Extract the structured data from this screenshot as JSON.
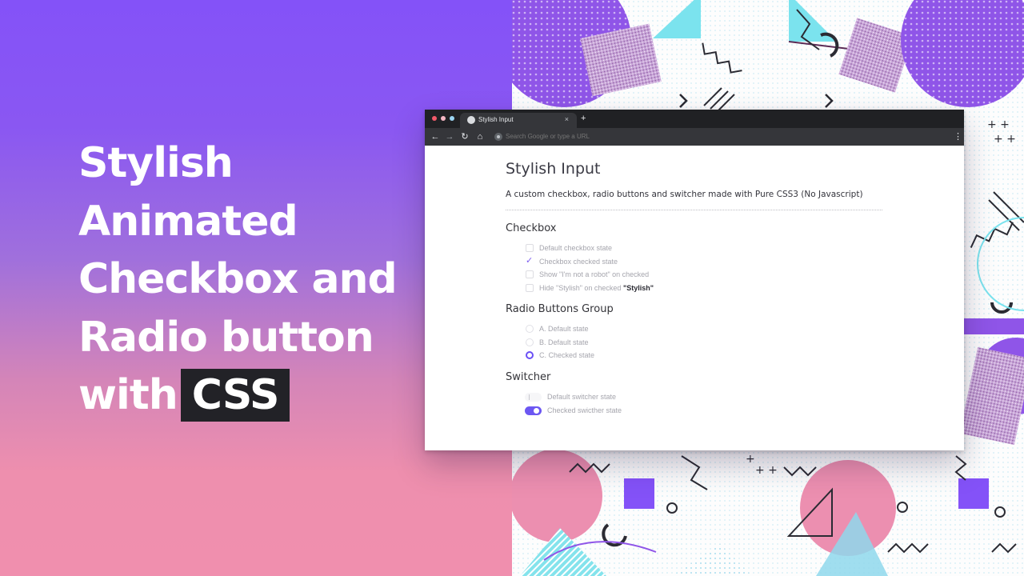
{
  "headline": {
    "lines": [
      "Stylish",
      "Animated",
      "Checkbox and",
      "Radio button"
    ],
    "last_prefix": "with",
    "highlight": "CSS"
  },
  "colors": {
    "gradient_top": "#8452f8",
    "gradient_bottom": "#f08fae",
    "accent": "#6c57f2",
    "browser_chrome": "#202124"
  },
  "browser": {
    "tab_title": "Stylish Input",
    "tab_close": "×",
    "new_tab": "+",
    "omnibox_placeholder": "Search Google or type a URL",
    "icons": {
      "back": "←",
      "forward": "→",
      "reload": "↻",
      "home": "⌂",
      "menu": "⋮"
    }
  },
  "page": {
    "title": "Stylish Input",
    "subtitle": "A custom checkbox, radio buttons and switcher made with Pure CSS3 (No Javascript)",
    "checkbox": {
      "title": "Checkbox",
      "items": [
        {
          "label": "Default checkbox state",
          "checked": false
        },
        {
          "label": "Checkbox checked state",
          "checked": true
        },
        {
          "label": "Show \"I'm not a robot\" on checked",
          "checked": false
        },
        {
          "label": "Hide \"Stylish\" on checked",
          "bold": "\"Stylish\"",
          "checked": false
        }
      ]
    },
    "radio": {
      "title": "Radio Buttons Group",
      "items": [
        {
          "label": "A. Default state",
          "checked": false
        },
        {
          "label": "B. Default state",
          "checked": false
        },
        {
          "label": "C. Checked state",
          "checked": true
        }
      ]
    },
    "switcher": {
      "title": "Switcher",
      "items": [
        {
          "label": "Default switcher state",
          "on": false
        },
        {
          "label": "Checked swicther state",
          "on": true
        }
      ]
    }
  }
}
